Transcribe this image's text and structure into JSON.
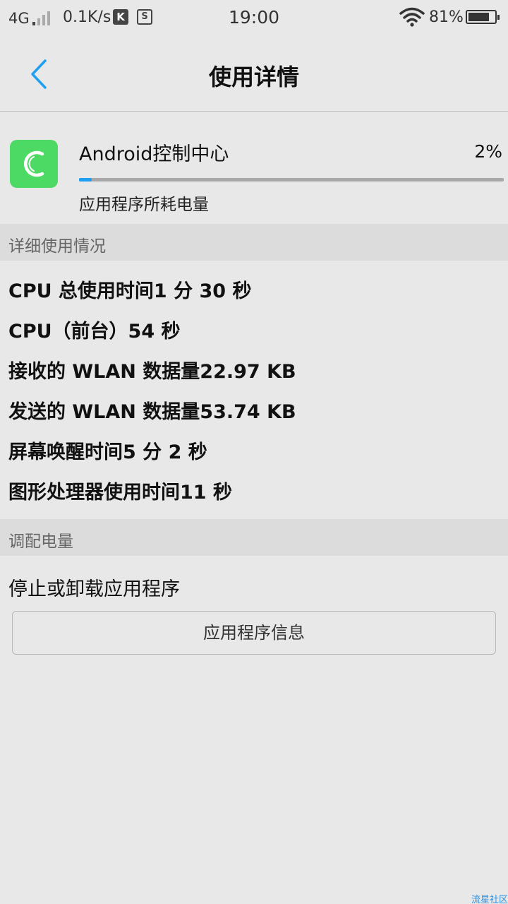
{
  "status_bar": {
    "network": "4G",
    "speed": "0.1K/s",
    "k_icon_label": "K",
    "s_icon_label": "S",
    "time": "19:00",
    "battery_percent": "81%",
    "battery_level": 0.81
  },
  "header": {
    "title": "使用详情"
  },
  "app": {
    "name": "Android控制中心",
    "percent": "2%",
    "usage_fraction": 0.03,
    "subtitle": "应用程序所耗电量",
    "icon": "c-logo-icon",
    "icon_color": "#4cd964"
  },
  "details_section": {
    "title": "详细使用情况",
    "items": [
      "CPU 总使用时间1 分 30 秒",
      "CPU（前台）54 秒",
      "接收的 WLAN 数据量22.97 KB",
      "发送的 WLAN 数据量53.74 KB",
      "屏幕唤醒时间5 分 2 秒",
      "图形处理器使用时间11 秒"
    ]
  },
  "adjust_section": {
    "title": "调配电量",
    "stop_label": "停止或卸载应用程序",
    "app_info_button": "应用程序信息"
  },
  "watermark": "流星社区",
  "colors": {
    "accent": "#1e9ff2",
    "background": "#e8e8e8",
    "section_header": "#dcdcdc"
  }
}
